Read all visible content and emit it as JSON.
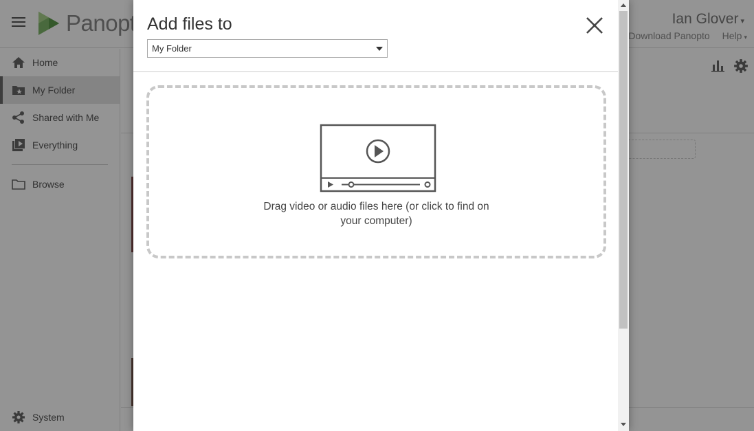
{
  "app": {
    "brand": "Panopto",
    "user_name": "Ian Glover",
    "top_links": [
      "Download Panopto",
      "Help"
    ]
  },
  "sidebar": {
    "items": [
      {
        "label": "Home",
        "icon": "home-icon"
      },
      {
        "label": "My Folder",
        "icon": "starred-folder-icon",
        "active": true
      },
      {
        "label": "Shared with Me",
        "icon": "share-icon"
      },
      {
        "label": "Everything",
        "icon": "video-library-icon"
      },
      {
        "label": "Browse",
        "icon": "folder-icon"
      }
    ],
    "system_label": "System"
  },
  "modal": {
    "title": "Add files to",
    "folder_select_value": "My Folder",
    "dropzone_text": "Drag video or audio files here (or click to find on your computer)"
  },
  "colors": {
    "overlay": "#6b6b6b",
    "dropzone_border": "#c8c8c8",
    "icon_gray": "#555555"
  }
}
